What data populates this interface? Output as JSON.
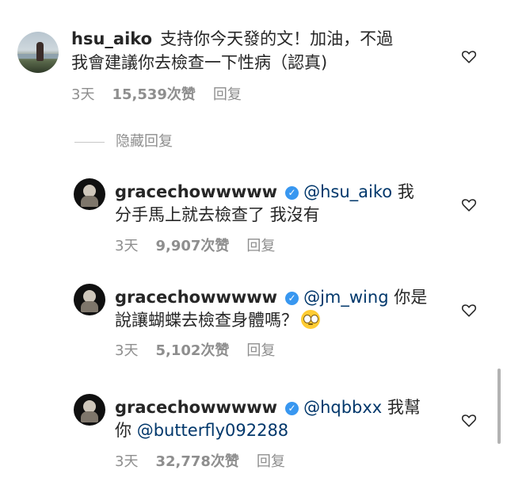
{
  "comments": [
    {
      "user": "hsu_aiko",
      "line1": "支持你今天發的文！加油，不過",
      "line2": "我會建議你去檢查一下性病（認真)",
      "time": "3天",
      "likes": "15,539次赞",
      "reply": "回复"
    }
  ],
  "hidden_replies_label": "隐藏回复",
  "replies": [
    {
      "user": "gracechowwwww",
      "mention": "@hsu_aiko",
      "line1_rest": "我",
      "line2": "分手馬上就去檢查了 我沒有",
      "time": "3天",
      "likes": "9,907次赞",
      "reply": "回复"
    },
    {
      "user": "gracechowwwww",
      "mention": "@jm_wing",
      "line1_rest": "你是",
      "line2": "說讓蝴蝶去檢查身體嗎？",
      "emoji": "face-with-rolling-eyes",
      "time": "3天",
      "likes": "5,102次赞",
      "reply": "回复"
    },
    {
      "user": "gracechowwwww",
      "mention": "@hqbbxx",
      "line1_rest": "我幫",
      "line2_prefix": "你",
      "line2_mention": "@butterfly092288",
      "time": "3天",
      "likes": "32,778次赞",
      "reply": "回复"
    }
  ],
  "icons": {
    "heart": "heart-outline-icon",
    "verified": "verified-badge-icon"
  },
  "colors": {
    "mention": "#00376b",
    "meta": "#8e8e8e",
    "verified": "#3897f0"
  }
}
